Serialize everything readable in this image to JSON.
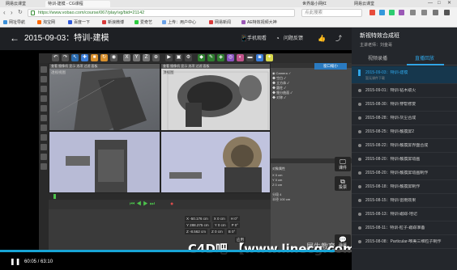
{
  "browser": {
    "tabs": [
      "网易云课堂",
      "特训-建模 - CG课程",
      "世界最小网红",
      "网易云课堂"
    ],
    "active_tab_index": 1,
    "url": "https://www.vobao.com/course/067/play/vg/bid=21142",
    "search_placeholder": "点此搜索",
    "bookmarks": [
      "网址导航",
      "淘宝网",
      "百度一下",
      "新浪微博",
      "爱奇艺",
      "上传：用户中心",
      "网易新闻",
      "AE特效视频大神"
    ],
    "window_controls": [
      "—",
      "□",
      "✕"
    ]
  },
  "header": {
    "back_glyph": "←",
    "title": "2015-09-03：特训-建模",
    "actions": [
      {
        "icon": "phone-icon",
        "glyph": "📱",
        "label": "手机观看"
      },
      {
        "icon": "question-icon",
        "glyph": "◔",
        "label": "问题反馈"
      },
      {
        "icon": "thumbs-up-icon",
        "glyph": "👍",
        "label": ""
      },
      {
        "icon": "share-icon",
        "glyph": "⤴",
        "label": ""
      }
    ]
  },
  "player": {
    "current_time": "60:05",
    "total_time": "63:10",
    "progress_fraction": 0.951,
    "play_glyph": "❚❚",
    "watermark": "C4D吧 【www.linecg.com/tieba/1799】",
    "logo_text": "犀牛教育",
    "side_buttons": [
      {
        "icon": "monitor-icon",
        "glyph": "🖵",
        "label": "课件"
      },
      {
        "icon": "copy-icon",
        "glyph": "⧉",
        "label": "投票"
      },
      {
        "icon": "chat-icon",
        "glyph": "💬",
        "label": "弹幕"
      }
    ],
    "popup_label": "窗口缩小",
    "viewports": [
      "透视视图",
      "顶视图",
      "右视图",
      "正视图"
    ],
    "coord_rows": [
      [
        "X  -50.176 cm",
        "X  0 cm",
        "H  0°"
      ],
      [
        "Y  288.275 cm",
        "Y  0 cm",
        "P  0°"
      ],
      [
        "Z  -8.562 cm",
        "Z  0 cm",
        "B  0°"
      ]
    ],
    "apply_label": "应用"
  },
  "sidebar": {
    "title": "新视特效合成班",
    "teacher": "主讲老师：刘金哥",
    "tabs": [
      "视频录播",
      "直播回放"
    ],
    "active_tab": 1,
    "items": [
      {
        "label": "2015-09-03：特训-建模",
        "sub": "暂无课件下载"
      },
      {
        "label": "2015-09-01：特训-钻木取火"
      },
      {
        "label": "2015-08-30：特训-穿帮修复"
      },
      {
        "label": "2015-08-28：特训-灰尘合成"
      },
      {
        "label": "2015-08-25：特训-触摸屏2"
      },
      {
        "label": "2015-08-22：特训-触摸屏界面合成"
      },
      {
        "label": "2015-08-20：特训-触摸屏动画"
      },
      {
        "label": "2015-08-20：特训-触摸屏动画制作"
      },
      {
        "label": "2015-08-18：特训-触摸屏制作"
      },
      {
        "label": "2015-08-15：特训-雷雨效果"
      },
      {
        "label": "2015-08-13：特训-跟踪-地记"
      },
      {
        "label": "2015-08-11：特训-粒子-跟踪准备"
      },
      {
        "label": "2015-08-08：Particular-唯美三维粒子制作"
      }
    ],
    "active_index": 0
  },
  "colors": {
    "accent": "#2fa6e8",
    "progress": "#18a5d6",
    "page_bg": "#202226"
  }
}
